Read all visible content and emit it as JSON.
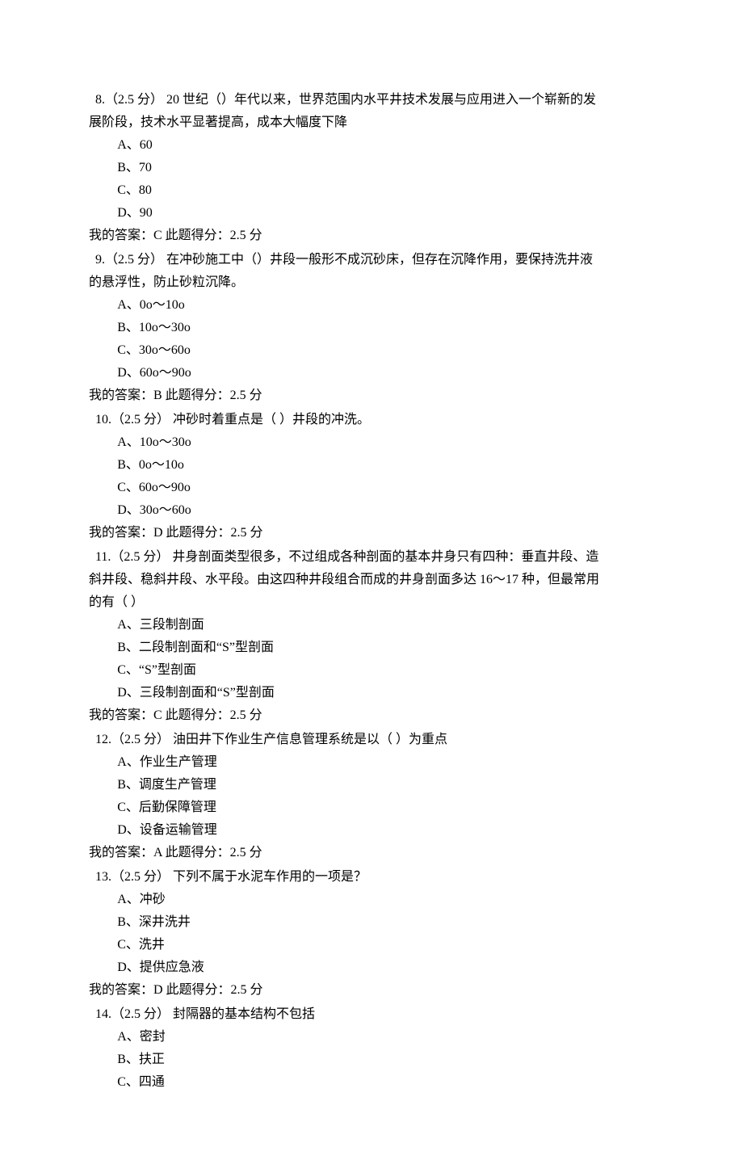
{
  "questions": [
    {
      "num": "8",
      "points": "（2.5 分）",
      "stem_lines": [
        " 8.（2.5 分）  20 世纪（）年代以来，世界范围内水平井技术发展与应用进入一个崭新的发",
        "展阶段，技术水平显著提高，成本大幅度下降"
      ],
      "options": [
        "A、60",
        "B、70",
        "C、80",
        "D、90"
      ],
      "answer_line": " 我的答案：C     此题得分：2.5 分"
    },
    {
      "num": "9",
      "points": "（2.5 分）",
      "stem_lines": [
        " 9.（2.5 分）  在冲砂施工中（）井段一般形不成沉砂床，但存在沉降作用，要保持洗井液",
        "的悬浮性，防止砂粒沉降。"
      ],
      "options": [
        "A、0o～10o",
        "B、10o～30o",
        "C、30o～60o",
        "D、60o～90o"
      ],
      "answer_line": " 我的答案：B     此题得分：2.5 分"
    },
    {
      "num": "10",
      "points": "（2.5 分）",
      "stem_lines": [
        " 10.（2.5 分）  冲砂时着重点是（  ）井段的冲洗。"
      ],
      "options": [
        "A、10o～30o",
        "B、0o～10o",
        "C、60o～90o",
        "D、30o～60o"
      ],
      "answer_line": " 我的答案：D     此题得分：2.5 分"
    },
    {
      "num": "11",
      "points": "（2.5 分）",
      "stem_lines": [
        " 11.（2.5 分）  井身剖面类型很多，不过组成各种剖面的基本井身只有四种：垂直井段、造",
        "斜井段、稳斜井段、水平段。由这四种井段组合而成的井身剖面多达 16～17 种，但最常用",
        "的有（  ）"
      ],
      "options": [
        "A、三段制剖面",
        "B、二段制剖面和“S”型剖面",
        "C、“S”型剖面",
        "D、三段制剖面和“S”型剖面"
      ],
      "answer_line": " 我的答案：C     此题得分：2.5 分"
    },
    {
      "num": "12",
      "points": "（2.5 分）",
      "stem_lines": [
        " 12.（2.5 分）  油田井下作业生产信息管理系统是以（  ）为重点"
      ],
      "options": [
        "A、作业生产管理",
        "B、调度生产管理",
        "C、后勤保障管理",
        "D、设备运输管理"
      ],
      "answer_line": " 我的答案：A     此题得分：2.5 分"
    },
    {
      "num": "13",
      "points": "（2.5 分）",
      "stem_lines": [
        " 13.（2.5 分）  下列不属于水泥车作用的一项是？"
      ],
      "options": [
        "A、冲砂",
        "B、深井洗井",
        "C、洗井",
        "D、提供应急液"
      ],
      "answer_line": " 我的答案：D     此题得分：2.5 分"
    },
    {
      "num": "14",
      "points": "（2.5 分）",
      "stem_lines": [
        " 14.（2.5 分）  封隔器的基本结构不包括"
      ],
      "options": [
        "A、密封",
        "B、扶正",
        "C、四通"
      ],
      "answer_line": ""
    }
  ]
}
